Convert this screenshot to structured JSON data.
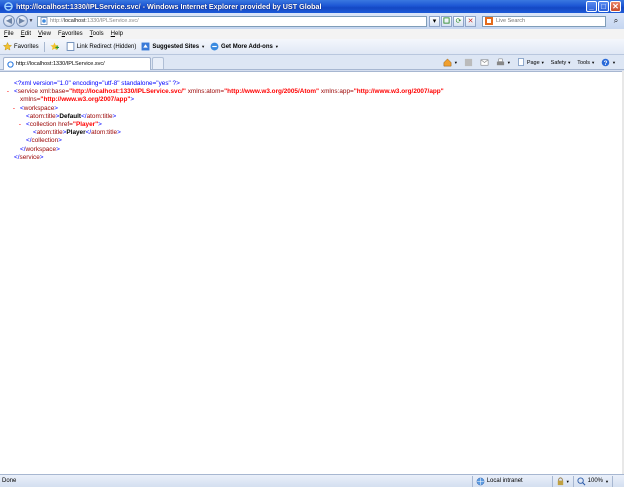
{
  "window": {
    "title": "http://localhost:1330/IPLService.svc/ - Windows Internet Explorer provided by UST Global",
    "minimize": "_",
    "maximize": "□",
    "close": "✕"
  },
  "nav": {
    "back": "◀",
    "forward": "▶",
    "address_host": "http://",
    "address_host_bold": "localhost",
    "address_rest": ":1330/IPLService.svc/",
    "search_placeholder": "Live Search"
  },
  "menu": [
    {
      "key": "F",
      "rest": "ile"
    },
    {
      "key": "E",
      "rest": "dit"
    },
    {
      "key": "V",
      "rest": "iew"
    },
    {
      "key": "F",
      "rest": "a",
      "tail": "vorites",
      "underline_index": 2
    },
    {
      "key": "T",
      "rest": "ools"
    },
    {
      "key": "H",
      "rest": "elp"
    }
  ],
  "menu_labels": [
    "File",
    "Edit",
    "View",
    "Favorites",
    "Tools",
    "Help"
  ],
  "favorites": {
    "favorites_label": "Favorites",
    "link_redirect": "Link Redirect (Hidden)",
    "suggested_sites": "Suggested Sites",
    "get_more_addons": "Get More Add-ons"
  },
  "tab": {
    "label": "http://localhost:1330/IPLService.svc/"
  },
  "commands": {
    "page": "Page",
    "safety": "Safety",
    "tools": "Tools"
  },
  "xml": {
    "decl": "<?xml version=\"1.0\" encoding=\"utf-8\" standalone=\"yes\" ?>",
    "service_open": "<service",
    "xml_base_attr": "xml:base=",
    "xml_base_val": "\"http://localhost:1330/IPLService.svc/\"",
    "xmlns_atom_attr": "xmlns:atom=",
    "xmlns_atom_val": "\"http://www.w3.org/2005/Atom\"",
    "xmlns_app_attr": "xmlns:app=",
    "xmlns_app_val": "\"http://www.w3.org/2007/app\"",
    "xmlns_attr": "xmlns=",
    "xmlns_val": "\"http://www.w3.org/2007/app\"",
    "workspace_open": "<workspace>",
    "atom_title_open": "<atom:title>",
    "default_text": "Default",
    "atom_title_close": "</atom:title>",
    "collection_open": "<collection",
    "href_attr": "href=",
    "href_val": "\"Player\"",
    "player_text": "Player",
    "collection_close": "</collection>",
    "workspace_close": "</workspace>",
    "service_close": "</service>"
  },
  "status": {
    "text": "Done",
    "zone": "Local intranet",
    "zoom": "100%"
  },
  "colors": {
    "titlebar": "#1c56d4",
    "xml_tag": "#990000",
    "xml_value": "#ff0000",
    "xml_decl": "#0000ff"
  }
}
